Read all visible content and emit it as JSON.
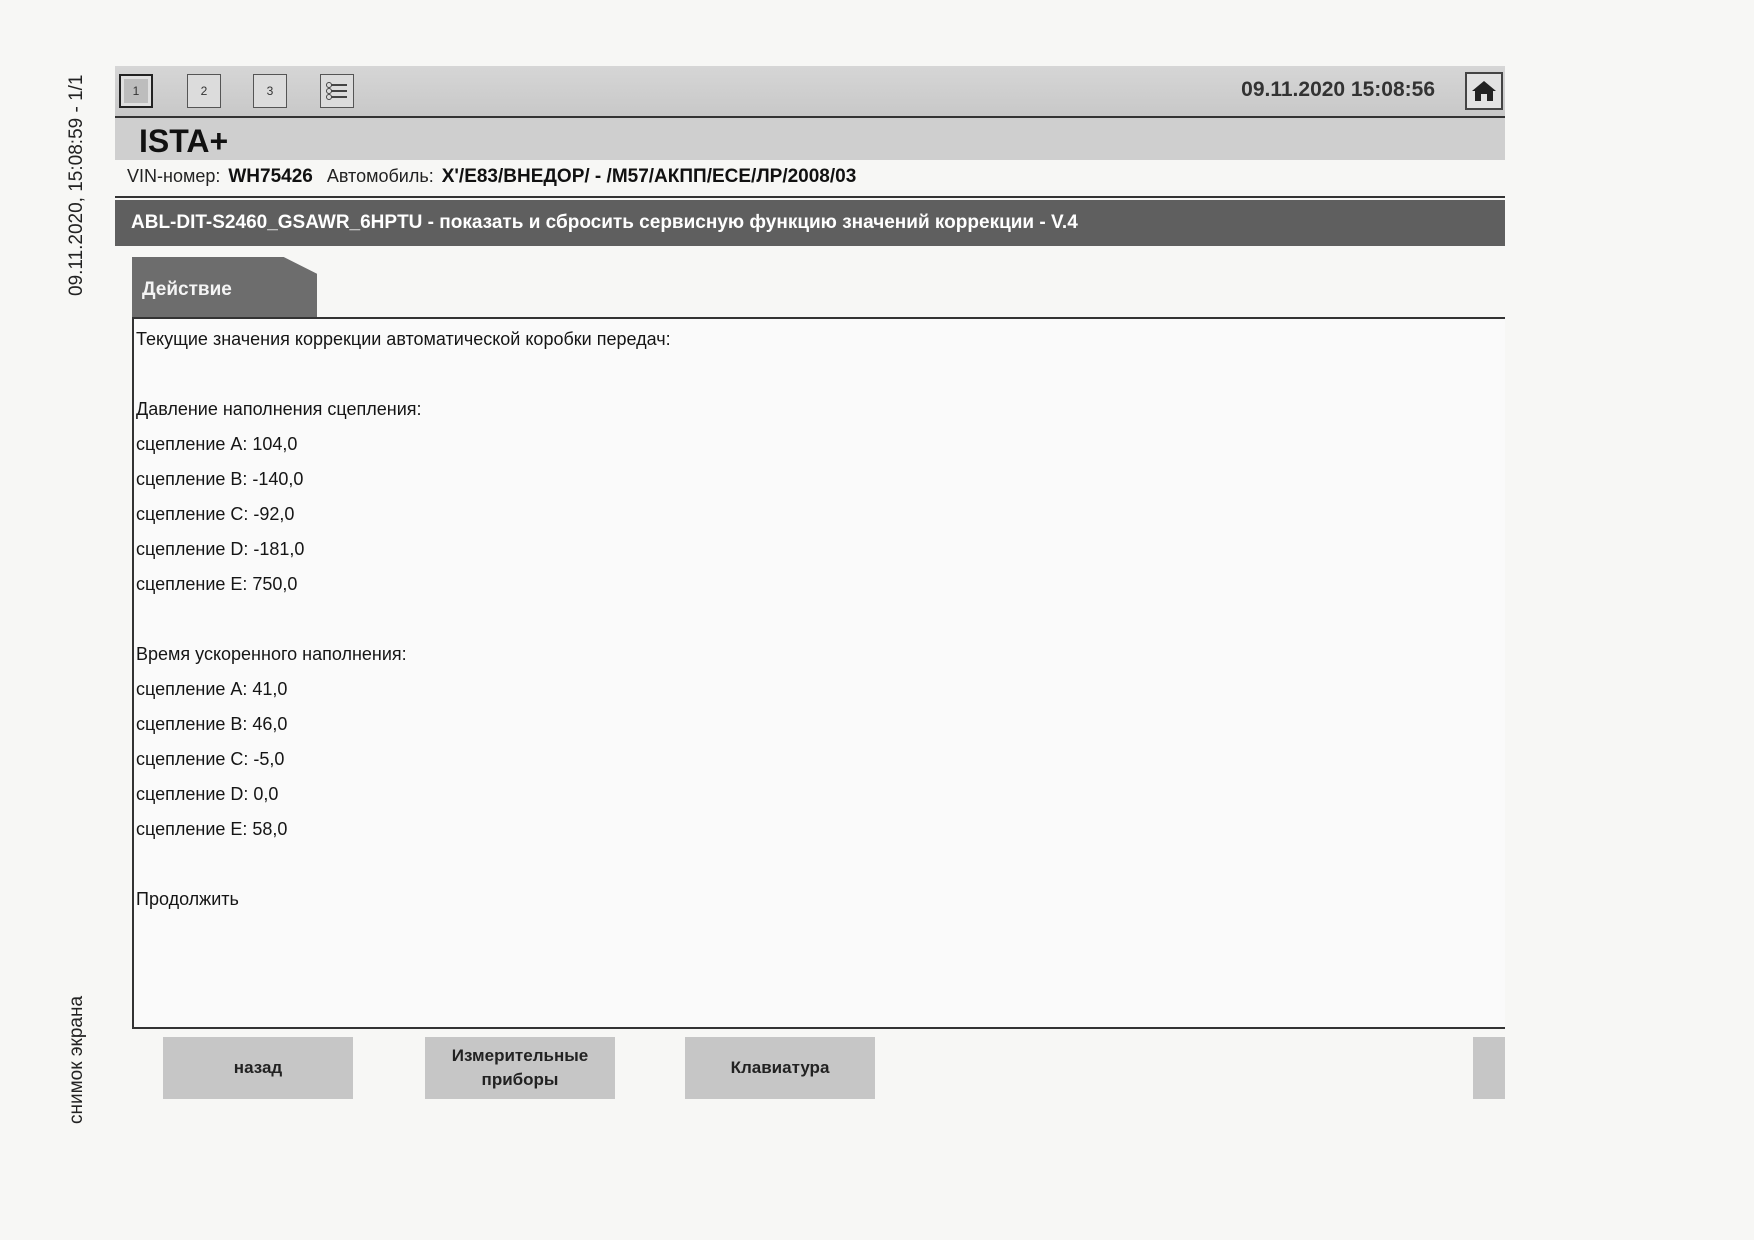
{
  "scan": {
    "side_top": "09.11.2020, 15:08:59 - 1/1",
    "side_bottom": "снимок экрана"
  },
  "toolbar": {
    "buttons": [
      "1",
      "2",
      "3"
    ],
    "datetime": "09.11.2020 15:08:56"
  },
  "app": {
    "title": "ISTA+"
  },
  "vehicle": {
    "vin_label": "VIN-номер:",
    "vin_value": "WH75426",
    "car_label": "Автомобиль:",
    "car_value": "X'/E83/ВНЕДОР/ - /M57/АКПП/ЕСЕ/ЛР/2008/03"
  },
  "function": {
    "title": "ABL-DIT-S2460_GSAWR_6HPTU - показать и сбросить сервисную функцию значений коррекции  - V.4"
  },
  "tab": {
    "label": "Действие"
  },
  "content": {
    "intro": "Текущие значения коррекции автоматической коробки передач:",
    "fill_pressure": {
      "heading": "Давление наполнения сцепления:",
      "items": [
        "сцепление A: 104,0",
        "сцепление B: -140,0",
        "сцепление C: -92,0",
        "сцепление D: -181,0",
        "сцепление E: 750,0"
      ]
    },
    "fast_fill_time": {
      "heading": "Время ускоренного наполнения:",
      "items": [
        "сцепление A: 41,0",
        "сцепление B: 46,0",
        "сцепление C: -5,0",
        "сцепление D: 0,0",
        "сцепление E: 58,0"
      ]
    },
    "continue": "Продолжить"
  },
  "footer": {
    "back": "назад",
    "instruments_line1": "Измерительные",
    "instruments_line2": "приборы",
    "keyboard": "Клавиатура"
  }
}
